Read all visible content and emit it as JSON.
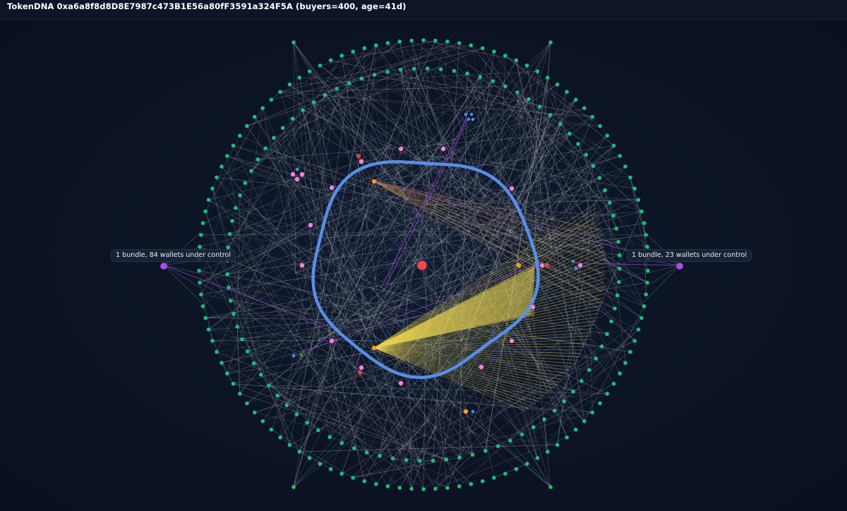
{
  "header": {
    "title": "TokenDNA 0xa6a8f8d8D8E7987c473B1E56a80fF3591a324F5A (buyers=400, age=41d)"
  },
  "graph": {
    "bundles": [
      {
        "id": "left",
        "label": "1 bundle, 84 wallets under control"
      },
      {
        "id": "right",
        "label": "1 bundle, 23 wallets under control"
      }
    ],
    "colors": {
      "background": "#0b1220",
      "edge": "#c9ced8",
      "outer_nodes": "#19c07a",
      "ring": "#5b93f0",
      "center_node": "#ff4545",
      "bundle_node": "#a44ff0",
      "pink_nodes": "#ff7ee2",
      "orange_nodes": "#ff9a1f",
      "red_nodes": "#e0403c",
      "blue_nodes": "#4c8ee8",
      "fan_edges": "#e8d250",
      "purple_edges": "#9c3fd6"
    }
  }
}
